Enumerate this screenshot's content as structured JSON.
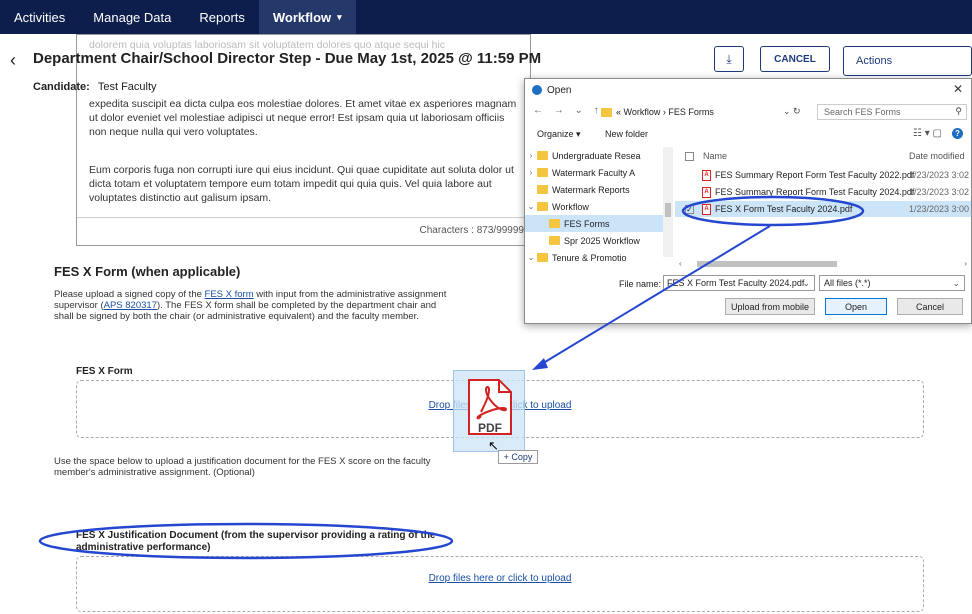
{
  "nav": {
    "items": [
      "Activities",
      "Manage Data",
      "Reports",
      "Workflow"
    ],
    "active_caret": "▾"
  },
  "header": {
    "back": "‹",
    "title": "Department Chair/School Director Step - Due May 1st, 2025 @ 11:59 PM",
    "candidate_label": "Candidate:",
    "candidate_name": "Test Faculty",
    "download_icon": "⤓",
    "cancel_label": "CANCEL",
    "actions_label": "Actions"
  },
  "textbox": {
    "faded_top": "dolorem quia voluptas laboriosam sit voluptatem dolores quo atque sequi hic",
    "para1_pre": "expedita suscipit ea dicta culpa eos molestiae dolores. Et amet vitae ex asperiores magnam ut dolor eveniet vel molestiae adipisci ut neque error! Est ipsam quia ut laboriosam officiis non neque nulla qui vero voluptates.",
    "para2": "Eum corporis fuga non corrupti iure qui eius incidunt. Qui quae cupiditate aut soluta dolor ut dicta totam et voluptatem tempore eum totam impedit qui quia quis. Vel quia labore aut voluptates distinctio aut galisum ipsam.",
    "characters": "Characters : 873/99999"
  },
  "fesx": {
    "title": "FES X  Form (when applicable)",
    "desc_1": "Please upload a signed copy of the ",
    "desc_link1": "FES X form",
    "desc_2": " with input from the administrative assignment supervisor (",
    "desc_link2": "APS 820317",
    "desc_3": "). The FES X form shall be completed by the department chair and shall be signed by both the chair (or administrative equivalent) and the faculty member.",
    "form_label": "FES X Form",
    "drop_text": "Drop files here or click to upload",
    "help": "Use the space below to upload a justification document for the FES X score on the faculty member's administrative assignment. (Optional)",
    "justification_label": "FES X Justification Document (from the supervisor providing a rating of the administrative performance)",
    "drop_text2": "Drop files here or click to upload"
  },
  "dialog": {
    "title": "Open",
    "close": "✕",
    "nav_arrows": "← → ⌄ ↑",
    "address": "« Workflow  ›  FES Forms",
    "address_dd": "⌄  ↻",
    "search_placeholder": "Search FES Forms",
    "organize": "Organize ▾",
    "new_folder": "New folder",
    "view_icons": "☷ ▾   ▢",
    "help": "?",
    "tree": [
      {
        "twisty": "›",
        "label": "Undergraduate Resea"
      },
      {
        "twisty": "›",
        "label": "Watermark Faculty A"
      },
      {
        "twisty": "",
        "label": "Watermark Reports"
      },
      {
        "twisty": "⌄",
        "label": "Workflow"
      },
      {
        "twisty": "",
        "label": "FES Forms"
      },
      {
        "twisty": "",
        "label": "Spr 2025 Workflow"
      },
      {
        "twisty": "⌄",
        "label": "Tenure & Promotio"
      }
    ],
    "list_header_name": "Name",
    "list_header_date": "Date modified",
    "files": [
      {
        "name": "FES Summary Report Form Test Faculty 2022.pdf",
        "date": "1/23/2023 3:02",
        "checked": ""
      },
      {
        "name": "FES Summary Report Form Test Faculty 2024.pdf",
        "date": "1/23/2023 3:02",
        "checked": ""
      },
      {
        "name": "FES X Form Test Faculty 2024.pdf",
        "date": "1/23/2023 3:00",
        "checked": "✓"
      }
    ],
    "pdf_glyph": "A",
    "filename_label": "File name:",
    "filename_value": "FES X Form Test Faculty 2024.pdf",
    "filetype_value": "All files (*.*)",
    "dd": "⌄",
    "upload_mobile": "Upload from mobile",
    "open": "Open",
    "cancel": "Cancel",
    "scroll_left": "‹",
    "scroll_right": "›"
  },
  "drag": {
    "pdf_label": "PDF",
    "copy_label": "+ Copy",
    "cursor": "↖"
  },
  "colors": {
    "nav_bg": "#0d1e4c",
    "brand_blue": "#1f3a7a",
    "annotation_blue": "#2547d0",
    "pdf_red": "#d22222"
  }
}
